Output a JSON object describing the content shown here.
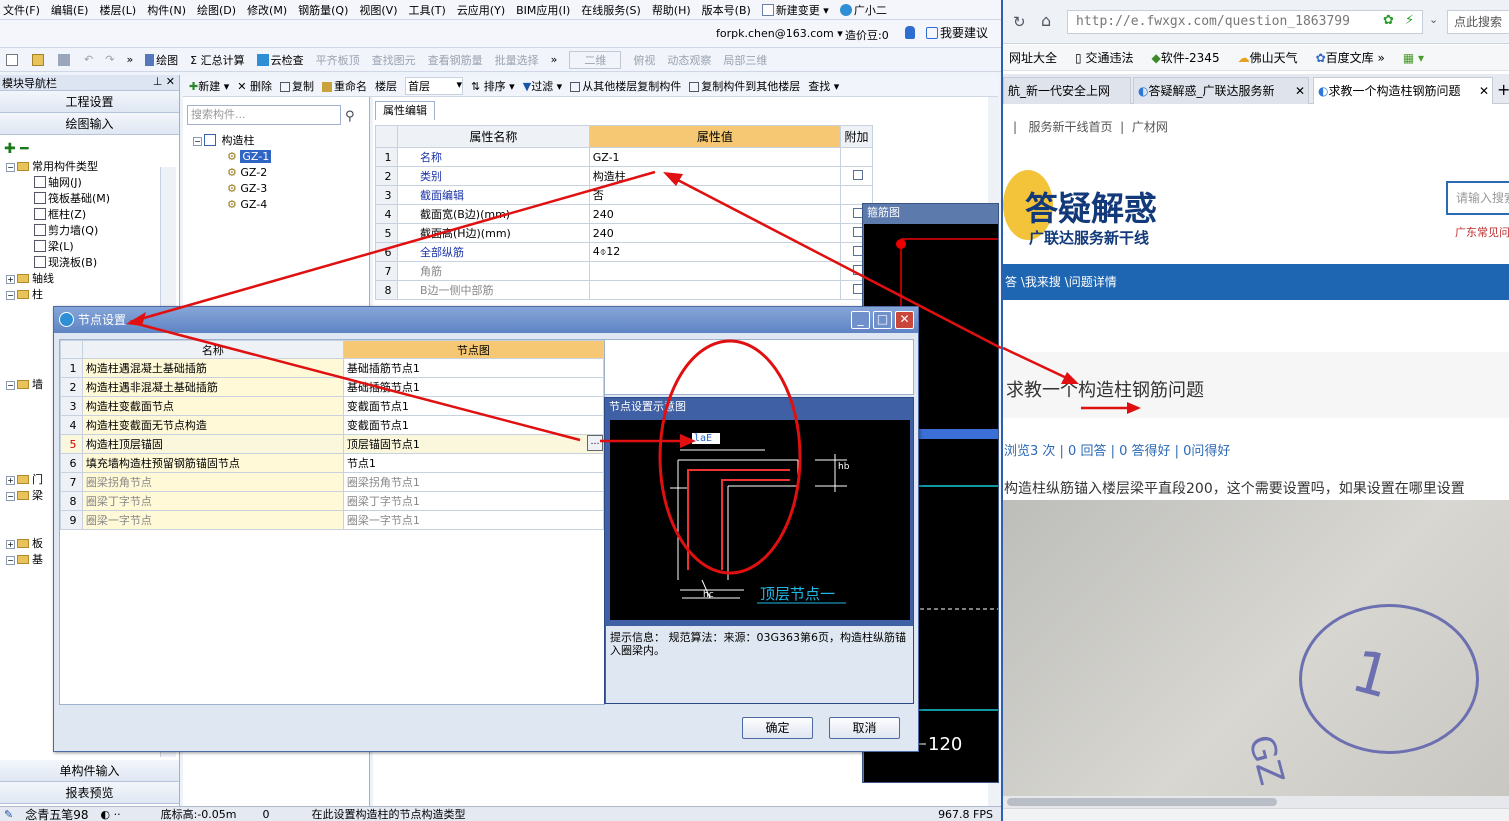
{
  "app": {
    "menu": [
      "文件(F)",
      "编辑(E)",
      "楼层(L)",
      "构件(N)",
      "绘图(D)",
      "修改(M)",
      "钢筋量(Q)",
      "视图(V)",
      "工具(T)",
      "云应用(Y)",
      "BIM应用(I)",
      "在线服务(S)",
      "帮助(H)",
      "版本号(B)",
      "新建变更",
      "广小二"
    ],
    "account": "forpk.chen@163.com",
    "price_beans": "造价豆:0",
    "suggest": "我要建议",
    "toolbar": [
      "绘图",
      "汇总计算",
      "云检查",
      "平齐板顶",
      "查找图元",
      "查看钢筋量",
      "批量选择",
      "二维",
      "俯视",
      "动态观察",
      "局部三维"
    ],
    "toolbar_disabled": [
      false,
      false,
      false,
      true,
      true,
      true,
      true,
      true,
      true,
      true,
      true
    ]
  },
  "nav": {
    "title": "模块导航栏",
    "btn_project": "工程设置",
    "btn_draw": "绘图输入",
    "tree_root": "常用构件类型",
    "tree_items": [
      "轴网(J)",
      "筏板基础(M)",
      "框柱(Z)",
      "剪力墙(Q)",
      "梁(L)",
      "现浇板(B)"
    ],
    "groups": [
      "轴线",
      "柱",
      "墙",
      "门",
      "梁",
      "板",
      "基"
    ],
    "btn_single": "单构件输入",
    "btn_report": "报表预览"
  },
  "comp_toolbar": [
    "新建",
    "删除",
    "复制",
    "重命名",
    "楼层",
    "首层",
    "排序",
    "过滤",
    "从其他楼层复制构件",
    "复制构件到其他楼层",
    "查找"
  ],
  "comp_list": {
    "search_placeholder": "搜索构件...",
    "root": "构造柱",
    "items": [
      "GZ-1",
      "GZ-2",
      "GZ-3",
      "GZ-4"
    ]
  },
  "props": {
    "tab": "属性编辑",
    "headers": [
      "属性名称",
      "属性值",
      "附加"
    ],
    "rows": [
      {
        "n": "1",
        "name": "名称",
        "value": "GZ-1"
      },
      {
        "n": "2",
        "name": "类别",
        "value": "构造柱"
      },
      {
        "n": "3",
        "name": "截面编辑",
        "value": "否"
      },
      {
        "n": "4",
        "name": "截面宽(B边)(mm)",
        "value": "240"
      },
      {
        "n": "5",
        "name": "截面高(H边)(mm)",
        "value": "240"
      },
      {
        "n": "6",
        "name": "全部纵筋",
        "value": "4⌽12"
      },
      {
        "n": "7",
        "name": "角筋",
        "value": ""
      },
      {
        "n": "8",
        "name": "B边一侧中部筋",
        "value": ""
      }
    ]
  },
  "stirrup_panel": {
    "title": "箍筋图",
    "value": "120"
  },
  "dialog": {
    "title": "节点设置",
    "headers": [
      "名称",
      "节点图"
    ],
    "rows": [
      {
        "n": "1",
        "name": "构造柱遇混凝土基础插筋",
        "value": "基础插筋节点1"
      },
      {
        "n": "2",
        "name": "构造柱遇非混凝土基础插筋",
        "value": "基础插筋节点1"
      },
      {
        "n": "3",
        "name": "构造柱变截面节点",
        "value": "变截面节点1"
      },
      {
        "n": "4",
        "name": "构造柱变截面无节点构造",
        "value": "变截面节点1"
      },
      {
        "n": "5",
        "name": "构造柱顶层锚固",
        "value": "顶层锚固节点1"
      },
      {
        "n": "6",
        "name": "填充墙构造柱预留钢筋锚固节点",
        "value": "节点1"
      },
      {
        "n": "7",
        "name": "圈梁拐角节点",
        "value": "圈梁拐角节点1"
      },
      {
        "n": "8",
        "name": "圈梁丁字节点",
        "value": "圈梁丁字节点1"
      },
      {
        "n": "9",
        "name": "圈梁一字节点",
        "value": "圈梁一字节点1"
      }
    ],
    "ok": "确定",
    "cancel": "取消"
  },
  "preview": {
    "title": "节点设置示意图",
    "label_lab": "laE",
    "label_hb": "hb",
    "label_hc": "hc",
    "caption": "顶层节点一",
    "info": "提示信息： 规范算法：来源：03G363第6页，构造柱纵筋锚入圈梁内。"
  },
  "status": {
    "left": "念青五笔98",
    "base": "底标高:-0.05m",
    "zero": "0",
    "hint": "在此设置构造柱的节点构造类型",
    "fps": "967.8 FPS"
  },
  "browser": {
    "url": "http://e.fwxgx.com/question_1863799",
    "search_hint": "点此搜索",
    "favs": [
      "网址大全",
      "交通违法",
      "软件-2345",
      "佛山天气",
      "百度文库"
    ],
    "tabs": [
      "航_新一代安全上网",
      "答疑解惑_广联达服务新",
      "求教一个构造柱钢筋问题"
    ],
    "links": [
      "服务新干线首页",
      "广材网"
    ],
    "logo_main": "答疑解惑",
    "logo_sub": "广联达服务新干线",
    "search_placeholder": "请输入搜索",
    "side_hint": "广东常见问",
    "breadcrumb": "答 \\我来搜 \\问题详情",
    "q_title": "求教一个构造柱钢筋问题",
    "q_stats": "浏览3 次 | 0 回答 | 0 答得好 | 0问得好",
    "q_text": "构造柱纵筋锚入楼层梁平直段200，这个需要设置吗，如果设置在哪里设置",
    "photo_text": "1",
    "photo_text2": "GZ",
    "colors": {
      "banner": "#1e66b2",
      "accent": "#2d5fb1"
    }
  }
}
